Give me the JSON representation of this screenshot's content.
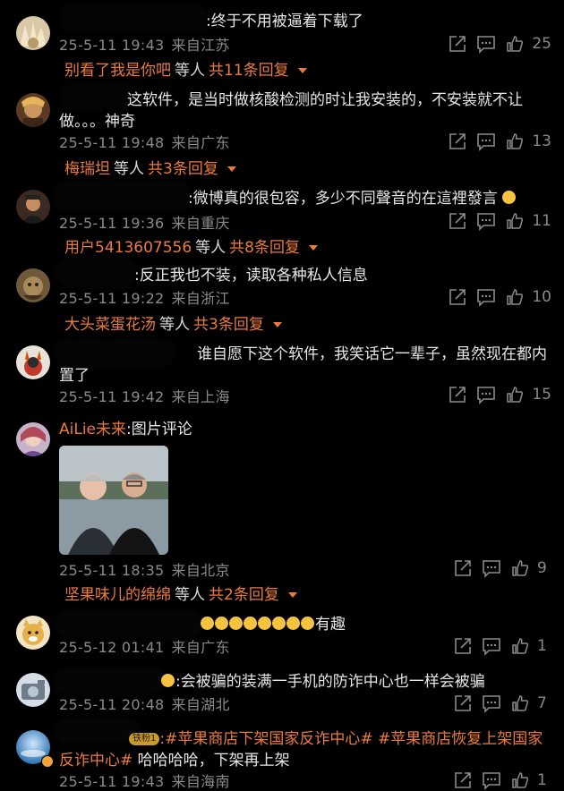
{
  "comments": [
    {
      "text": ":终于不用被逼着下载了",
      "time": "25-5-11 19:43",
      "location": "来自江苏",
      "likes": "25",
      "replies": {
        "user": "别看了我是你吧",
        "mid": "等人",
        "count": "共11条回复"
      }
    },
    {
      "text": "这软件，是当时做核酸检测的时让我安装的，不安装就不让做。。。神奇",
      "time": "25-5-11 19:48",
      "location": "来自广东",
      "likes": "13",
      "replies": {
        "user": "梅瑞坦",
        "mid": "等人",
        "count": "共3条回复"
      }
    },
    {
      "text": ":微博真的很包容，多少不同聲音的在這裡發言",
      "time": "25-5-11 19:36",
      "location": "来自重庆",
      "likes": "11",
      "replies": {
        "user": "用户5413607556",
        "mid": "等人",
        "count": "共8条回复"
      }
    },
    {
      "text": ":反正我也不装，读取各种私人信息",
      "time": "25-5-11 19:22",
      "location": "来自浙江",
      "likes": "10",
      "replies": {
        "user": "大头菜蛋花汤",
        "mid": "等人",
        "count": "共3条回复"
      }
    },
    {
      "text": "谁自愿下这个软件，我笑话它一辈子，虽然现在都内置了",
      "time": "25-5-11 19:42",
      "location": "来自上海",
      "likes": "15"
    },
    {
      "username": "AiLie未来",
      "text": ":图片评论",
      "time": "25-5-11 18:35",
      "location": "来自北京",
      "likes": "9",
      "replies": {
        "user": "坚果味儿的绵绵",
        "mid": "等人",
        "count": "共2条回复"
      }
    },
    {
      "text": "有趣",
      "time": "25-5-12 01:41",
      "location": "来自广东",
      "likes": "1"
    },
    {
      "text": ":会被骗的装满一手机的防诈中心也一样会被骗",
      "time": "25-5-11 20:48",
      "location": "来自湖北",
      "likes": "7"
    },
    {
      "badge": "铁粉1",
      "hashtag1": ":#苹果商店下架国家反诈中心#",
      "hashtag2": "#苹果商店恢复上架国家反诈中心#",
      "text_tail": " 哈哈哈哈，下架再上架",
      "time": "25-5-11 19:43",
      "location": "来自海南",
      "likes": "1"
    }
  ],
  "colors": {
    "accent": "#eb7a3f",
    "meta": "#8a8a8a",
    "background": "#000000"
  }
}
